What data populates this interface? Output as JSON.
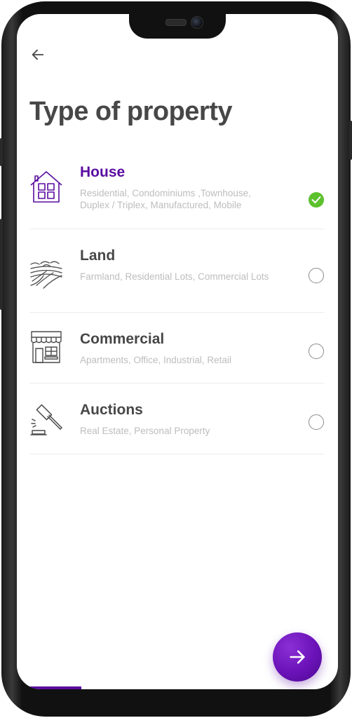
{
  "header": {
    "back_icon": "arrow-left-icon",
    "title": "Type of property"
  },
  "options": [
    {
      "title": "House",
      "description": "Residential, Condominiums ,Townhouse, Duplex / Triplex, Manufactured, Mobile",
      "icon": "house-icon",
      "selected": true
    },
    {
      "title": "Land",
      "description": "Farmland, Residential Lots, Commercial Lots",
      "icon": "farmland-icon",
      "selected": false
    },
    {
      "title": "Commercial",
      "description": "Apartments, Office, Industrial, Retail",
      "icon": "storefront-icon",
      "selected": false
    },
    {
      "title": "Auctions",
      "description": "Real Estate, Personal Property",
      "icon": "gavel-icon",
      "selected": false
    }
  ],
  "next_button": {
    "icon": "arrow-right-icon"
  },
  "progress": {
    "fraction": 0.2
  },
  "colors": {
    "accent": "#5a0da0",
    "check": "#5cc12d",
    "title_text": "#474747",
    "muted_text": "#bdbdbd"
  }
}
